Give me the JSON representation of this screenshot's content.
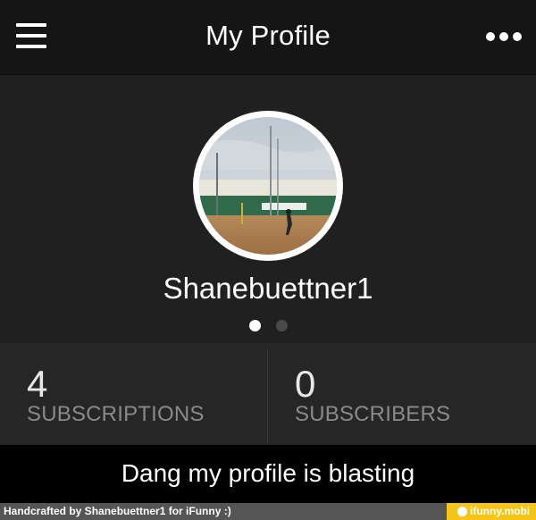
{
  "header": {
    "title": "My Profile",
    "menu_icon": "hamburger-menu-icon",
    "more_icon": "more-dots-icon"
  },
  "profile": {
    "username": "Shanebuettner1",
    "avatar_icon": "profile-photo",
    "pager": {
      "count": 2,
      "active_index": 0
    }
  },
  "stats": {
    "subscriptions": {
      "value": "4",
      "label": "SUBSCRIPTIONS"
    },
    "subscribers": {
      "value": "0",
      "label": "SUBSCRIBERS"
    }
  },
  "bio": "Dang my profile is blasting",
  "footer": {
    "credit": "Handcrafted by Shanebuettner1 for iFunny :)",
    "site": "ifunny.mobi"
  },
  "colors": {
    "topbar": "#151515",
    "profile_bg": "#202020",
    "stats_bg": "#262626",
    "label_gray": "#8a8a8a",
    "footer_bg": "#555555",
    "ifunny_yellow": "#f5c518"
  }
}
